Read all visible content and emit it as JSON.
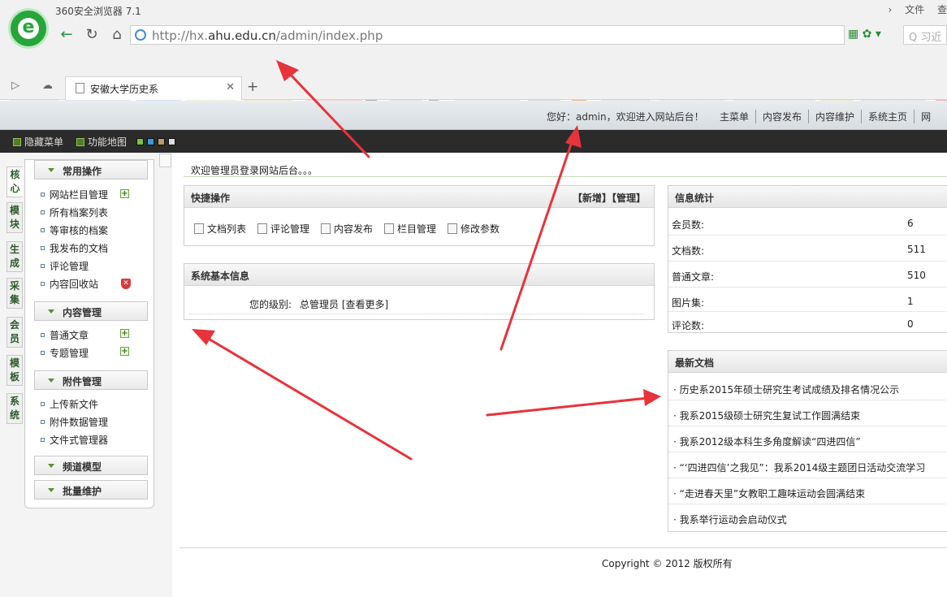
{
  "browser": {
    "title": "360安全浏览器 7.1",
    "window_buttons": [
      "›",
      "文件",
      "查"
    ],
    "url_prefix": "http://hx.",
    "url_domain": "ahu.edu.cn",
    "url_path": "/admin/index.php",
    "search_placeholder": "习近",
    "tab_title": "安徽大学历史系"
  },
  "admin": {
    "welcome_text": "您好：admin，欢迎进入网站后台！",
    "nav": [
      "主菜单",
      "内容发布",
      "内容维护",
      "系统主页",
      "网"
    ],
    "bar_buttons": [
      "隐藏菜单",
      "功能地图"
    ],
    "skin_colors": [
      "#7cbf3b",
      "#3a9bd9",
      "#b89b6a",
      "#dddddd"
    ]
  },
  "left_tabs": [
    "核心",
    "模块",
    "生成",
    "采集",
    "会员",
    "模板",
    "系统"
  ],
  "menu": {
    "groups": [
      {
        "title": "常用操作",
        "items": [
          "网站栏目管理",
          "所有档案列表",
          "等审核的档案",
          "我发布的文档",
          "评论管理",
          "内容回收站"
        ]
      },
      {
        "title": "内容管理",
        "items": [
          "普通文章",
          "专题管理"
        ]
      },
      {
        "title": "附件管理",
        "items": [
          "上传新文件",
          "附件数据管理",
          "文件式管理器"
        ]
      },
      {
        "title": "频道模型",
        "items": []
      },
      {
        "title": "批量维护",
        "items": []
      }
    ]
  },
  "main": {
    "greeting": "欢迎管理员登录网站后台。。。",
    "quick": {
      "title": "快捷操作",
      "actions": "【新增】【管理】",
      "links": [
        "文档列表",
        "评论管理",
        "内容发布",
        "栏目管理",
        "修改参数"
      ]
    },
    "sysinfo": {
      "title": "系统基本信息",
      "label": "您的级别:",
      "value": "总管理员 [查看更多]"
    },
    "stats": {
      "title": "信息统计",
      "rows": [
        {
          "label": "会员数:",
          "value": "6"
        },
        {
          "label": "文档数:",
          "value": "511"
        },
        {
          "label": "普通文章:",
          "value": "510"
        },
        {
          "label": "图片集:",
          "value": "1"
        },
        {
          "label": "评论数:",
          "value": "0"
        }
      ]
    },
    "latest": {
      "title": "最新文档",
      "items": [
        "· 历史系2015年硕士研究生考试成绩及排名情况公示",
        "· 我系2015级硕士研究生复试工作圆满结束",
        "· 我系2012级本科生多角度解读“四进四信”",
        "· “‘四进四信’之我见”：我系2014级主题团日活动交流学习",
        "· “走进春天里”女教职工趣味运动会圆满结束",
        "· 我系举行运动会启动仪式"
      ]
    },
    "footer": "Copyright © 2012 版权所有"
  }
}
